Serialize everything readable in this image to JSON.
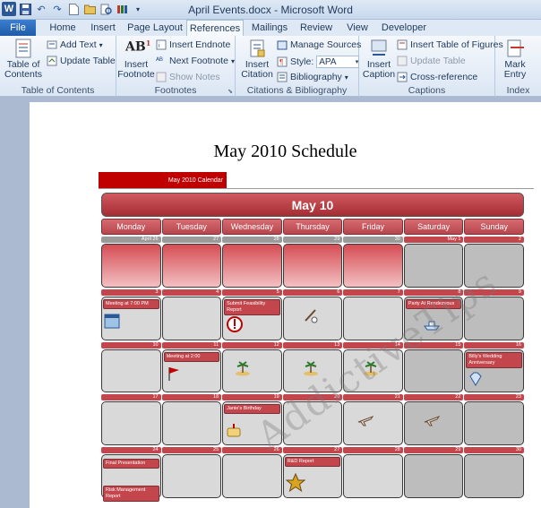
{
  "window": {
    "title": "April Events.docx - Microsoft Word"
  },
  "tabs": [
    "File",
    "Home",
    "Insert",
    "Page Layout",
    "References",
    "Mailings",
    "Review",
    "View",
    "Developer"
  ],
  "ribbon": {
    "toc": {
      "big": "Table of\nContents",
      "add_text": "Add Text",
      "update_table": "Update Table",
      "label": "Table of Contents"
    },
    "footnotes": {
      "big": "Insert\nFootnote",
      "insert_endnote": "Insert Endnote",
      "next_footnote": "Next Footnote",
      "show_notes": "Show Notes",
      "label": "Footnotes"
    },
    "citations": {
      "big": "Insert\nCitation",
      "manage_sources": "Manage Sources",
      "style_label": "Style:",
      "style_value": "APA",
      "bibliography": "Bibliography",
      "label": "Citations & Bibliography"
    },
    "captions": {
      "big": "Insert\nCaption",
      "insert_tof": "Insert Table of Figures",
      "update_table": "Update Table",
      "cross_reference": "Cross-reference",
      "label": "Captions"
    },
    "index": {
      "big": "Mark\nEntry",
      "label": "Index"
    }
  },
  "document": {
    "title": "May 2010 Schedule",
    "calendar_tab": "May 2010 Calendar",
    "calendar": {
      "month": "May 10",
      "days": [
        "Monday",
        "Tuesday",
        "Wednesday",
        "Thursday",
        "Friday",
        "Saturday",
        "Sunday"
      ],
      "weeks": [
        {
          "nums": [
            "April 26",
            "27",
            "28",
            "29",
            "30",
            "May 1",
            "2"
          ]
        },
        {
          "nums": [
            "3",
            "4",
            "5",
            "6",
            "7",
            "8",
            "9"
          ]
        },
        {
          "nums": [
            "10",
            "11",
            "12",
            "13",
            "14",
            "15",
            "16"
          ]
        },
        {
          "nums": [
            "17",
            "18",
            "19",
            "20",
            "21",
            "22",
            "23"
          ]
        },
        {
          "nums": [
            "24",
            "25",
            "26",
            "27",
            "28",
            "29",
            "30"
          ]
        }
      ],
      "events": {
        "meeting_7": "Meeting at 7:00 PM",
        "submit": "Submit Feasibility Report",
        "party": "Party At Rendezvous",
        "meeting_2": "Meeting at 2:00",
        "billy": "Billy's Wedding Anniversary",
        "janie": "Janie's Birthday",
        "final": "Final Presentation",
        "risk": "Risk Management Report",
        "rd": "R&D Report"
      }
    },
    "watermark": "AddictiveTips"
  }
}
